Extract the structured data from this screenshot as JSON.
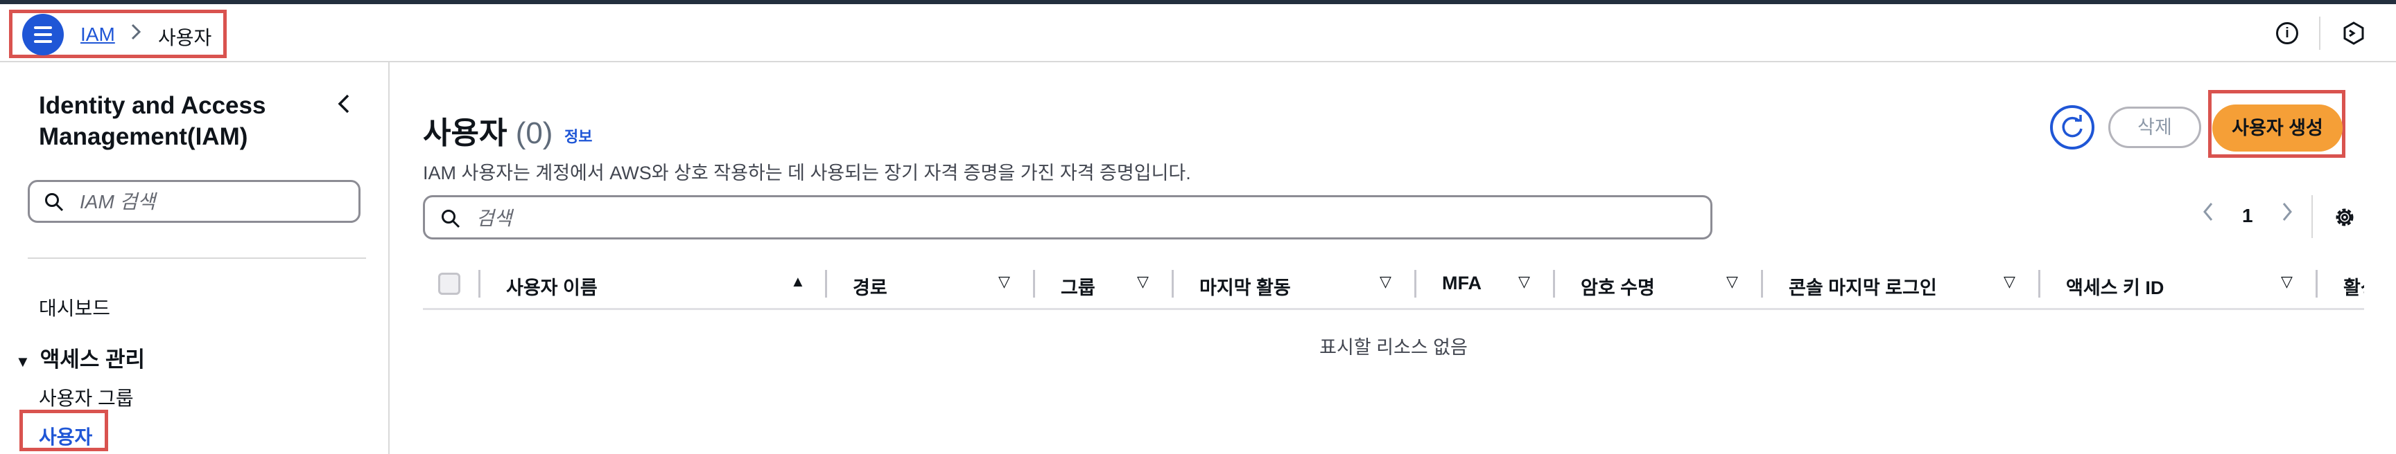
{
  "breadcrumb": {
    "root": "IAM",
    "separator": ">",
    "current": "사용자"
  },
  "header_icons": [
    "info-icon",
    "cloudshell-icon"
  ],
  "sidebar": {
    "title": "Identity and Access Management(IAM)",
    "collapse_icon": "chevron-left-icon",
    "search_placeholder": "IAM 검색",
    "dashboard": "대시보드",
    "section_title": "액세스 관리",
    "items": [
      {
        "label": "사용자 그룹"
      },
      {
        "label": "사용자",
        "active": true
      }
    ]
  },
  "main": {
    "title": "사용자",
    "count": "(0)",
    "info_link": "정보",
    "description": "IAM 사용자는 계정에서 AWS와 상호 작용하는 데 사용되는 장기 자격 증명을 가진 자격 증명입니다.",
    "refresh_icon": "refresh-icon",
    "delete_label": "삭제",
    "create_label": "사용자 생성",
    "search_placeholder": "검색",
    "pagination": {
      "current_page": "1"
    },
    "settings_icon": "gear-icon",
    "columns": [
      {
        "label": "사용자 이름",
        "sort": "▲"
      },
      {
        "label": "경로",
        "sort": "▽"
      },
      {
        "label": "그룹",
        "sort": "▽"
      },
      {
        "label": "마지막 활동",
        "sort": "▽"
      },
      {
        "label": "MFA",
        "sort": "▽"
      },
      {
        "label": "암호 수명",
        "sort": "▽"
      },
      {
        "label": "콘솔 마지막 로그인",
        "sort": "▽"
      },
      {
        "label": "액세스 키 ID",
        "sort": "▽"
      },
      {
        "label": "활성"
      }
    ],
    "empty_message": "표시할 리소스 없음"
  },
  "colors": {
    "accent_blue": "#1f56d6",
    "primary_button": "#f59f37",
    "highlight_box": "#d9534f",
    "top_strip": "#232f3e"
  }
}
